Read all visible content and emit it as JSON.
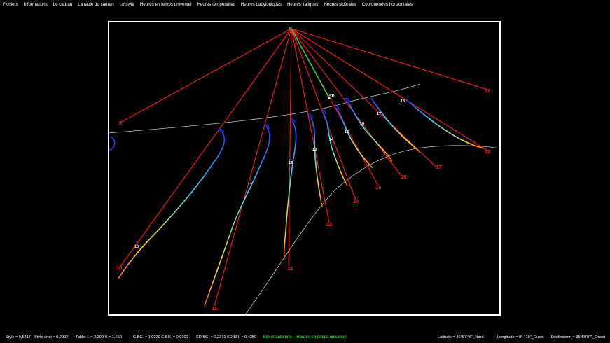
{
  "menu": [
    "Fichiers",
    "Informations",
    "Le cadran",
    "La table du cadran",
    "Le style",
    "Heures en temps universel",
    "Heures temporaires",
    "Heures babyloniques",
    "Heures italiques",
    "Heures sidérales",
    "Coordonnées horizontales"
  ],
  "dial": {
    "center_label": "C",
    "sd_label": "SD",
    "red_hour_labels": [
      "9",
      "10",
      "11",
      "12",
      "13",
      "14",
      "15",
      "16",
      "17",
      "18",
      "19"
    ],
    "white_hour_labels": [
      "10",
      "11",
      "12",
      "13",
      "14",
      "15",
      "16",
      "17",
      "18"
    ],
    "colors": {
      "hour_line": "#ff1a1a",
      "substyle_line": "#28e028",
      "equinox_line": "#bfbfbf",
      "analemma_start": "#1e3cff",
      "analemma_mid": "#2ed8ff",
      "analemma_end": "#ffd21e",
      "frame": "#ffffff"
    }
  },
  "status": {
    "style": "Style = 0,5417",
    "style_droit": "Style droit = 0,2992",
    "table": "Table:  L.= 2,200   H.= 1,650",
    "cbg": "C.BG. = 1,0220   C.BH. = 0,0300",
    "sdbg": "SD.BG. = 1,2371   SD.BH. = 0,4259",
    "season": "Eté et automne _ Heures en temps universel",
    "latitude": "Latitude = 46°57'46\"_Nord",
    "longitude": "Longitude = 0°  ' 19\"_Ouest",
    "declinaison": "Déclinaison = 35°58'07\"_Ouest"
  }
}
